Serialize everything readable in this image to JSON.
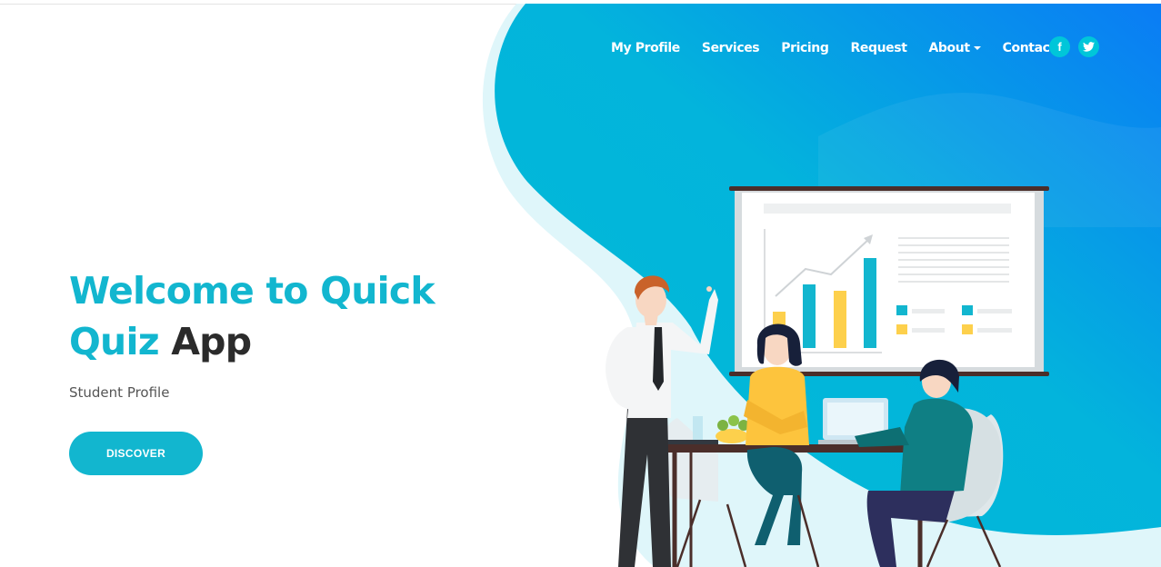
{
  "colors": {
    "accent": "#12b6cf",
    "dark_text": "#2b2b2b",
    "gradient_start": "#00bcd4",
    "gradient_end": "#0a7cf5"
  },
  "nav": {
    "items": [
      {
        "label": "My Profile"
      },
      {
        "label": "Services"
      },
      {
        "label": "Pricing"
      },
      {
        "label": "Request"
      },
      {
        "label": "About"
      },
      {
        "label": "Contact"
      }
    ],
    "social": [
      {
        "icon": "facebook-icon",
        "glyph": "f"
      },
      {
        "icon": "twitter-icon",
        "glyph": "bird"
      }
    ]
  },
  "hero": {
    "title_part1": "Welcome to Quick",
    "title_part2": "Quiz",
    "title_part3": "App",
    "subtitle": "Student Profile",
    "cta_label": "DISCOVER"
  }
}
